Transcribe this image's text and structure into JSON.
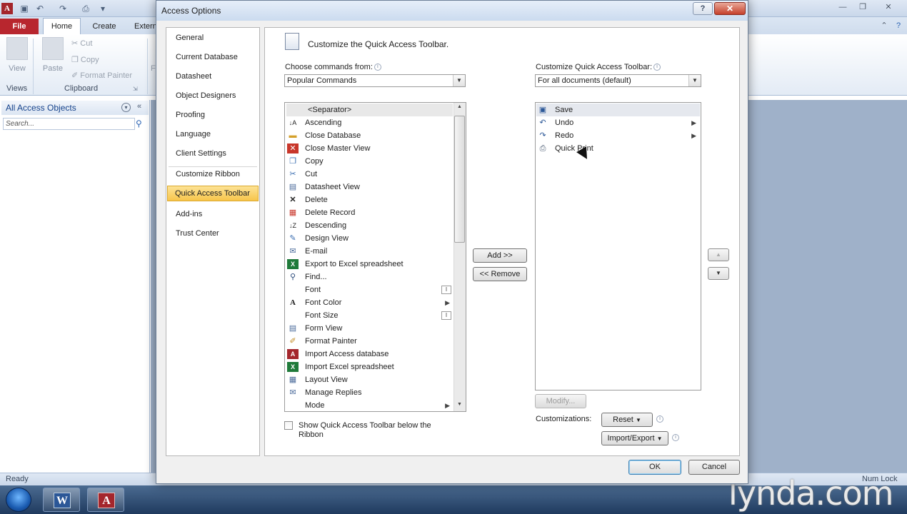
{
  "app": {
    "logo": "A",
    "ribbon_tabs": [
      "File",
      "Home",
      "Create",
      "Extern"
    ],
    "ribbon": {
      "view_label": "View",
      "paste_label": "Paste",
      "cut_label": "Cut",
      "copy_label": "Copy",
      "format_painter_label": "Format Painter",
      "group_views": "Views",
      "group_clipboard": "Clipboard",
      "f_stub": "F"
    },
    "nav_pane": {
      "title": "All Access Objects",
      "search_placeholder": "Search..."
    },
    "status_left": "Ready",
    "status_right": "Num Lock",
    "taskbar": {
      "word_glyph": "W",
      "access_glyph": "A"
    },
    "watermark": "lynda.com"
  },
  "dialog": {
    "title": "Access Options",
    "help_glyph": "?",
    "close_glyph": "✕",
    "categories": [
      "General",
      "Current Database",
      "Datasheet",
      "Object Designers",
      "Proofing",
      "Language",
      "Client Settings",
      "Customize Ribbon",
      "Quick Access Toolbar",
      "Add-ins",
      "Trust Center"
    ],
    "selected_category": "Quick Access Toolbar",
    "heading": "Customize the Quick Access Toolbar.",
    "choose_commands_label": "Choose commands from:",
    "choose_commands_value": "Popular Commands",
    "customize_qat_label": "Customize Quick Access Toolbar:",
    "customize_qat_value": "For all documents (default)",
    "commands": [
      {
        "label": "<Separator>",
        "icon": "separator",
        "glyph": ""
      },
      {
        "label": "Ascending",
        "icon": "sort-ascending-icon",
        "glyph": "↓A"
      },
      {
        "label": "Close Database",
        "icon": "folder-icon",
        "glyph": "▬"
      },
      {
        "label": "Close Master View",
        "icon": "close-red-icon",
        "glyph": "✕"
      },
      {
        "label": "Copy",
        "icon": "copy-icon",
        "glyph": "❐"
      },
      {
        "label": "Cut",
        "icon": "scissors-icon",
        "glyph": "✂"
      },
      {
        "label": "Datasheet View",
        "icon": "datasheet-icon",
        "glyph": "▤"
      },
      {
        "label": "Delete",
        "icon": "delete-x-icon",
        "glyph": "✕"
      },
      {
        "label": "Delete Record",
        "icon": "delete-record-icon",
        "glyph": "▦"
      },
      {
        "label": "Descending",
        "icon": "sort-descending-icon",
        "glyph": "↓Z"
      },
      {
        "label": "Design View",
        "icon": "design-view-icon",
        "glyph": "✎"
      },
      {
        "label": "E-mail",
        "icon": "email-icon",
        "glyph": "✉"
      },
      {
        "label": "Export to Excel spreadsheet",
        "icon": "excel-export-icon",
        "glyph": "X"
      },
      {
        "label": "Find...",
        "icon": "binoculars-icon",
        "glyph": "⚲"
      },
      {
        "label": "Font",
        "icon": "none",
        "glyph": "",
        "sub": "box"
      },
      {
        "label": "Font Color",
        "icon": "font-color-icon",
        "glyph": "A",
        "sub": "arrow"
      },
      {
        "label": "Font Size",
        "icon": "none",
        "glyph": "",
        "sub": "box"
      },
      {
        "label": "Form View",
        "icon": "form-view-icon",
        "glyph": "▤"
      },
      {
        "label": "Format Painter",
        "icon": "paintbrush-icon",
        "glyph": "✐"
      },
      {
        "label": "Import Access database",
        "icon": "access-import-icon",
        "glyph": "A"
      },
      {
        "label": "Import Excel spreadsheet",
        "icon": "excel-import-icon",
        "glyph": "X"
      },
      {
        "label": "Layout View",
        "icon": "layout-view-icon",
        "glyph": "▦"
      },
      {
        "label": "Manage Replies",
        "icon": "replies-icon",
        "glyph": "✉"
      },
      {
        "label": "Mode",
        "icon": "none",
        "glyph": "",
        "sub": "arrow"
      }
    ],
    "add_button": "Add >>",
    "remove_button": "<< Remove",
    "toolbar_items": [
      {
        "label": "Save",
        "icon": "save-icon",
        "glyph": "▣",
        "sub": ""
      },
      {
        "label": "Undo",
        "icon": "undo-icon",
        "glyph": "↶",
        "sub": "arrow"
      },
      {
        "label": "Redo",
        "icon": "redo-icon",
        "glyph": "↷",
        "sub": "arrow"
      },
      {
        "label": "Quick Print",
        "icon": "printer-icon",
        "glyph": "⎙",
        "sub": ""
      }
    ],
    "modify_button": "Modify...",
    "customizations_label": "Customizations:",
    "reset_button": "Reset",
    "import_export_button": "Import/Export",
    "show_below_label": "Show Quick Access Toolbar below the Ribbon",
    "ok_button": "OK",
    "cancel_button": "Cancel"
  },
  "colors": {
    "selected_category": "#f7c54b",
    "file_tab": "#b8262e",
    "close_button": "#c5402b"
  }
}
